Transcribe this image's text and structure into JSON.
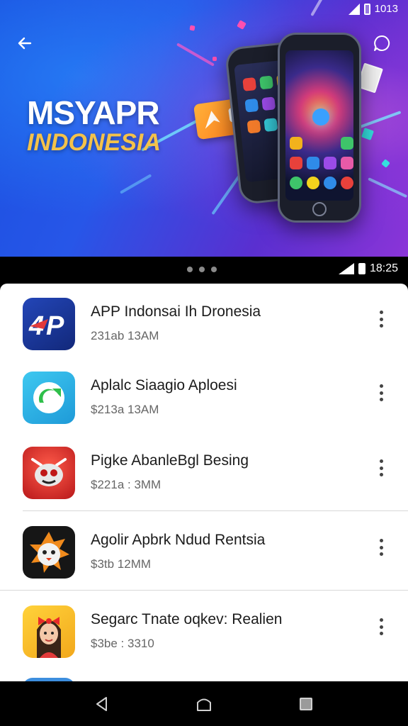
{
  "status_bar_top": {
    "time": "1013"
  },
  "banner": {
    "title_line1": "MSYAPR",
    "title_line2": "INDONESIA",
    "ticket_number": "10",
    "icons": {
      "back": "arrow-left-icon",
      "chat": "chat-bubble-icon"
    }
  },
  "status_bar": {
    "time": "18:25"
  },
  "pager": {
    "page_count": 3
  },
  "apps": [
    {
      "name": "APP Indonsai Ih Dronesia",
      "meta": "231ab 13AM",
      "icon": "4p-logo-icon"
    },
    {
      "name": "Aplalc Siaagio Aploesi",
      "meta": "$213a 13AM",
      "icon": "green-arrow-icon"
    },
    {
      "name": "Pigke AbanleBgl Besing",
      "meta": "$221a : 3MM",
      "icon": "red-mascot-icon"
    },
    {
      "name": "Agolir Apbrk Ndud Rentsia",
      "meta": "$3tb 12MM",
      "icon": "penguin-badge-icon"
    },
    {
      "name": "Segarc Tnate oqkev: Realien",
      "meta": "$3be : 3310",
      "icon": "girl-avatar-icon"
    }
  ],
  "colors": {
    "banner_blue": "#2756e8",
    "banner_purple": "#8b35d8",
    "title_gold": "#f4c24a",
    "app1_blue": "#1c3aa0",
    "app2_cyan": "#25b4e8",
    "app3_red": "#d42a2a",
    "app4_black": "#1a1a1a",
    "app5_yellow": "#f6c21c"
  },
  "nav": {
    "back": "triangle-back-icon",
    "home": "home-icon",
    "recents": "square-recents-icon"
  }
}
